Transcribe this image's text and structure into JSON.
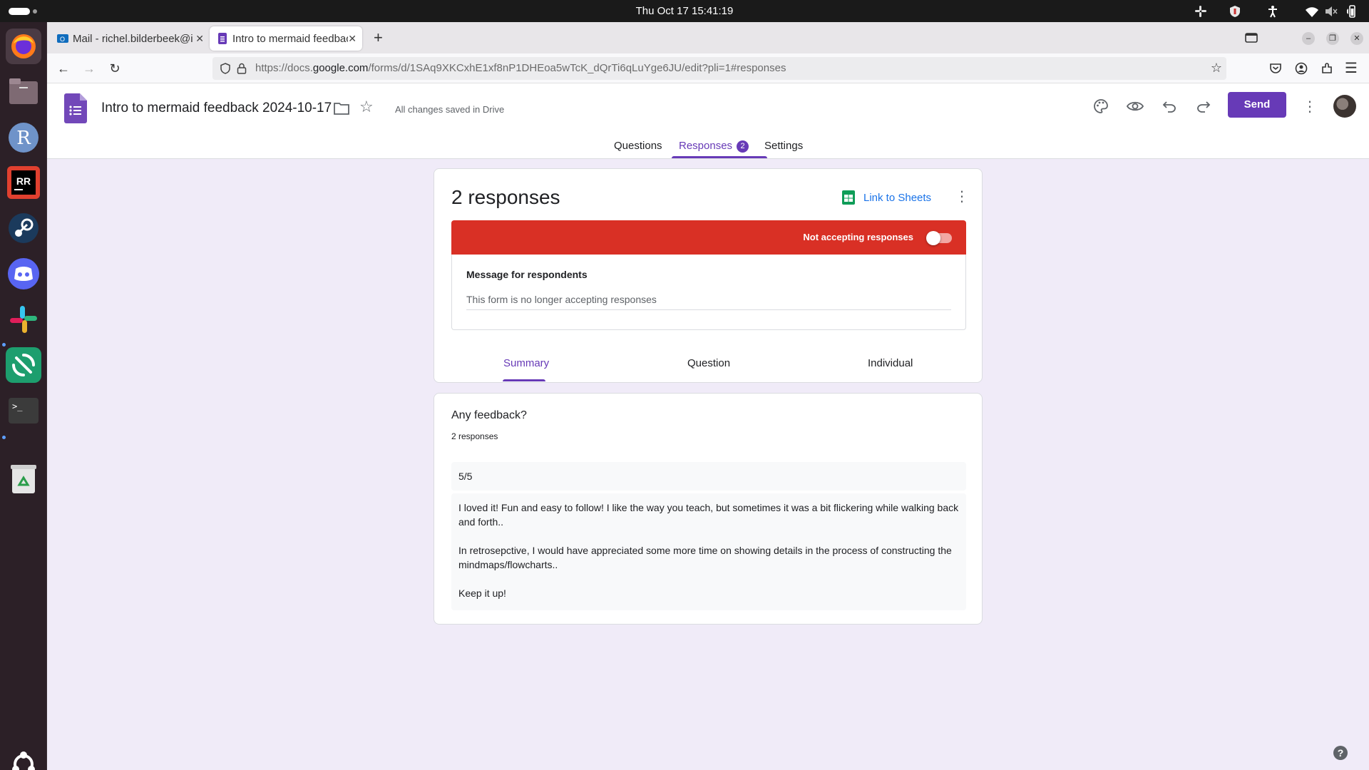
{
  "system": {
    "clock": "Thu Oct 17  15:41:19"
  },
  "browser": {
    "tabs": [
      {
        "label": "Mail - richel.bilderbeek@i",
        "icon": "outlook-icon"
      },
      {
        "label": "Intro to mermaid feedbac",
        "icon": "google-forms-icon"
      }
    ],
    "url_prefix": "https://docs.",
    "url_host": "google.com",
    "url_path": "/forms/d/1SAq9XKCxhE1xf8nP1DHEoa5wTcK_dQrTi6qLuYge6JU/edit?pli=1#responses"
  },
  "form": {
    "title": "Intro to mermaid feedback 2024-10-17",
    "save_status": "All changes saved in Drive",
    "send_label": "Send",
    "tabs": {
      "questions": "Questions",
      "responses": "Responses",
      "responses_badge": "2",
      "settings": "Settings"
    }
  },
  "responses": {
    "count_title": "2 responses",
    "link_sheets": "Link to Sheets",
    "accepting_label": "Not accepting responses",
    "accepting_on": false,
    "message_label": "Message for respondents",
    "message_value": "This form is no longer accepting responses",
    "subtabs": {
      "summary": "Summary",
      "question": "Question",
      "individual": "Individual"
    }
  },
  "question": {
    "title": "Any feedback?",
    "count": "2 responses",
    "answers": [
      {
        "paragraphs": [
          "5/5"
        ]
      },
      {
        "paragraphs": [
          "I loved it! Fun and easy to follow! I like the way you teach, but sometimes it was a bit flickering while walking back and forth..",
          "In retrosepctive, I would have appreciated some more time on showing details in the process of constructing the mindmaps/flowcharts..",
          "Keep it up!"
        ]
      }
    ]
  },
  "colors": {
    "accent": "#673ab7",
    "banner": "#d93025",
    "link": "#1a73e8",
    "page_bg": "#f0ebf8"
  }
}
